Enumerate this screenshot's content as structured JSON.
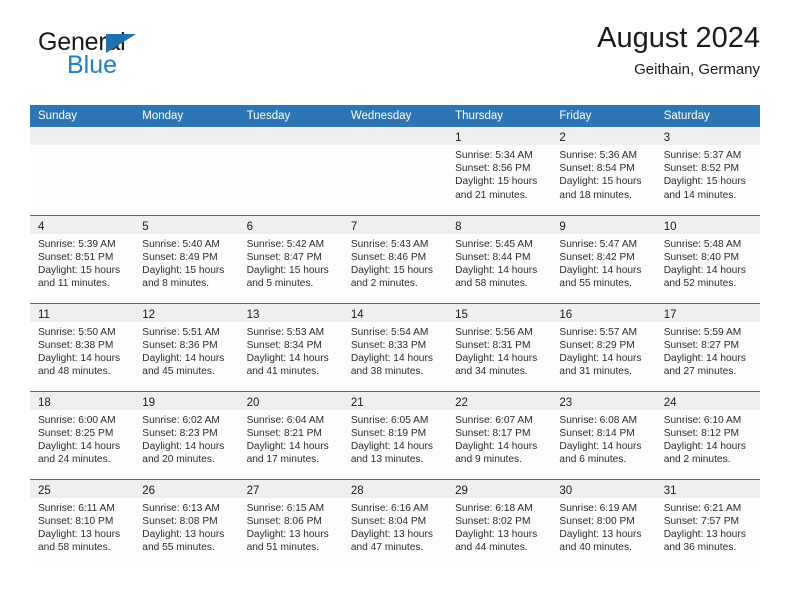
{
  "brand": {
    "word_general": "General",
    "word_blue": "Blue",
    "triangle_color": "#1f6fb5",
    "blue_color": "#1f7fc4"
  },
  "header": {
    "title": "August 2024",
    "subtitle": "Geithain, Germany"
  },
  "theme": {
    "header_blue": "#2e75b6",
    "daynum_band": "#efefef",
    "cell_bg": "#fdfdfd"
  },
  "weekdays": [
    "Sunday",
    "Monday",
    "Tuesday",
    "Wednesday",
    "Thursday",
    "Friday",
    "Saturday"
  ],
  "weeks": [
    [
      {
        "empty": true
      },
      {
        "empty": true
      },
      {
        "empty": true
      },
      {
        "empty": true
      },
      {
        "day": "1",
        "sunrise": "Sunrise: 5:34 AM",
        "sunset": "Sunset: 8:56 PM",
        "daylight1": "Daylight: 15 hours",
        "daylight2": "and 21 minutes."
      },
      {
        "day": "2",
        "sunrise": "Sunrise: 5:36 AM",
        "sunset": "Sunset: 8:54 PM",
        "daylight1": "Daylight: 15 hours",
        "daylight2": "and 18 minutes."
      },
      {
        "day": "3",
        "sunrise": "Sunrise: 5:37 AM",
        "sunset": "Sunset: 8:52 PM",
        "daylight1": "Daylight: 15 hours",
        "daylight2": "and 14 minutes."
      }
    ],
    [
      {
        "day": "4",
        "sunrise": "Sunrise: 5:39 AM",
        "sunset": "Sunset: 8:51 PM",
        "daylight1": "Daylight: 15 hours",
        "daylight2": "and 11 minutes."
      },
      {
        "day": "5",
        "sunrise": "Sunrise: 5:40 AM",
        "sunset": "Sunset: 8:49 PM",
        "daylight1": "Daylight: 15 hours",
        "daylight2": "and 8 minutes."
      },
      {
        "day": "6",
        "sunrise": "Sunrise: 5:42 AM",
        "sunset": "Sunset: 8:47 PM",
        "daylight1": "Daylight: 15 hours",
        "daylight2": "and 5 minutes."
      },
      {
        "day": "7",
        "sunrise": "Sunrise: 5:43 AM",
        "sunset": "Sunset: 8:46 PM",
        "daylight1": "Daylight: 15 hours",
        "daylight2": "and 2 minutes."
      },
      {
        "day": "8",
        "sunrise": "Sunrise: 5:45 AM",
        "sunset": "Sunset: 8:44 PM",
        "daylight1": "Daylight: 14 hours",
        "daylight2": "and 58 minutes."
      },
      {
        "day": "9",
        "sunrise": "Sunrise: 5:47 AM",
        "sunset": "Sunset: 8:42 PM",
        "daylight1": "Daylight: 14 hours",
        "daylight2": "and 55 minutes."
      },
      {
        "day": "10",
        "sunrise": "Sunrise: 5:48 AM",
        "sunset": "Sunset: 8:40 PM",
        "daylight1": "Daylight: 14 hours",
        "daylight2": "and 52 minutes."
      }
    ],
    [
      {
        "day": "11",
        "sunrise": "Sunrise: 5:50 AM",
        "sunset": "Sunset: 8:38 PM",
        "daylight1": "Daylight: 14 hours",
        "daylight2": "and 48 minutes."
      },
      {
        "day": "12",
        "sunrise": "Sunrise: 5:51 AM",
        "sunset": "Sunset: 8:36 PM",
        "daylight1": "Daylight: 14 hours",
        "daylight2": "and 45 minutes."
      },
      {
        "day": "13",
        "sunrise": "Sunrise: 5:53 AM",
        "sunset": "Sunset: 8:34 PM",
        "daylight1": "Daylight: 14 hours",
        "daylight2": "and 41 minutes."
      },
      {
        "day": "14",
        "sunrise": "Sunrise: 5:54 AM",
        "sunset": "Sunset: 8:33 PM",
        "daylight1": "Daylight: 14 hours",
        "daylight2": "and 38 minutes."
      },
      {
        "day": "15",
        "sunrise": "Sunrise: 5:56 AM",
        "sunset": "Sunset: 8:31 PM",
        "daylight1": "Daylight: 14 hours",
        "daylight2": "and 34 minutes."
      },
      {
        "day": "16",
        "sunrise": "Sunrise: 5:57 AM",
        "sunset": "Sunset: 8:29 PM",
        "daylight1": "Daylight: 14 hours",
        "daylight2": "and 31 minutes."
      },
      {
        "day": "17",
        "sunrise": "Sunrise: 5:59 AM",
        "sunset": "Sunset: 8:27 PM",
        "daylight1": "Daylight: 14 hours",
        "daylight2": "and 27 minutes."
      }
    ],
    [
      {
        "day": "18",
        "sunrise": "Sunrise: 6:00 AM",
        "sunset": "Sunset: 8:25 PM",
        "daylight1": "Daylight: 14 hours",
        "daylight2": "and 24 minutes."
      },
      {
        "day": "19",
        "sunrise": "Sunrise: 6:02 AM",
        "sunset": "Sunset: 8:23 PM",
        "daylight1": "Daylight: 14 hours",
        "daylight2": "and 20 minutes."
      },
      {
        "day": "20",
        "sunrise": "Sunrise: 6:04 AM",
        "sunset": "Sunset: 8:21 PM",
        "daylight1": "Daylight: 14 hours",
        "daylight2": "and 17 minutes."
      },
      {
        "day": "21",
        "sunrise": "Sunrise: 6:05 AM",
        "sunset": "Sunset: 8:19 PM",
        "daylight1": "Daylight: 14 hours",
        "daylight2": "and 13 minutes."
      },
      {
        "day": "22",
        "sunrise": "Sunrise: 6:07 AM",
        "sunset": "Sunset: 8:17 PM",
        "daylight1": "Daylight: 14 hours",
        "daylight2": "and 9 minutes."
      },
      {
        "day": "23",
        "sunrise": "Sunrise: 6:08 AM",
        "sunset": "Sunset: 8:14 PM",
        "daylight1": "Daylight: 14 hours",
        "daylight2": "and 6 minutes."
      },
      {
        "day": "24",
        "sunrise": "Sunrise: 6:10 AM",
        "sunset": "Sunset: 8:12 PM",
        "daylight1": "Daylight: 14 hours",
        "daylight2": "and 2 minutes."
      }
    ],
    [
      {
        "day": "25",
        "sunrise": "Sunrise: 6:11 AM",
        "sunset": "Sunset: 8:10 PM",
        "daylight1": "Daylight: 13 hours",
        "daylight2": "and 58 minutes."
      },
      {
        "day": "26",
        "sunrise": "Sunrise: 6:13 AM",
        "sunset": "Sunset: 8:08 PM",
        "daylight1": "Daylight: 13 hours",
        "daylight2": "and 55 minutes."
      },
      {
        "day": "27",
        "sunrise": "Sunrise: 6:15 AM",
        "sunset": "Sunset: 8:06 PM",
        "daylight1": "Daylight: 13 hours",
        "daylight2": "and 51 minutes."
      },
      {
        "day": "28",
        "sunrise": "Sunrise: 6:16 AM",
        "sunset": "Sunset: 8:04 PM",
        "daylight1": "Daylight: 13 hours",
        "daylight2": "and 47 minutes."
      },
      {
        "day": "29",
        "sunrise": "Sunrise: 6:18 AM",
        "sunset": "Sunset: 8:02 PM",
        "daylight1": "Daylight: 13 hours",
        "daylight2": "and 44 minutes."
      },
      {
        "day": "30",
        "sunrise": "Sunrise: 6:19 AM",
        "sunset": "Sunset: 8:00 PM",
        "daylight1": "Daylight: 13 hours",
        "daylight2": "and 40 minutes."
      },
      {
        "day": "31",
        "sunrise": "Sunrise: 6:21 AM",
        "sunset": "Sunset: 7:57 PM",
        "daylight1": "Daylight: 13 hours",
        "daylight2": "and 36 minutes."
      }
    ]
  ]
}
